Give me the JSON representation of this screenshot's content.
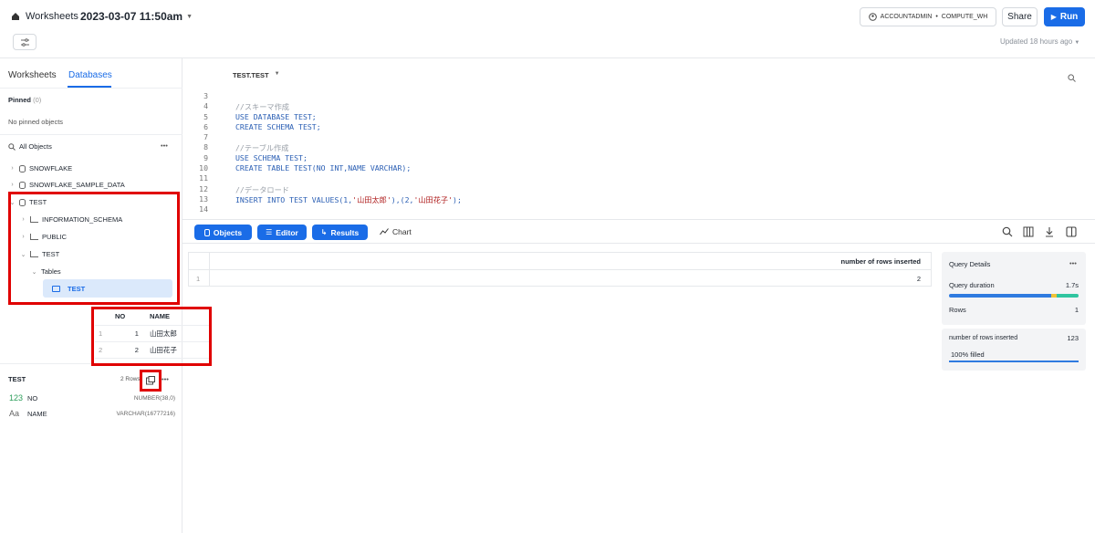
{
  "header": {
    "breadcrumb": "Worksheets",
    "worksheet_title": "2023-03-07 11:50am",
    "role": "ACCOUNTADMIN",
    "separator": "•",
    "warehouse": "COMPUTE_WH",
    "share_label": "Share",
    "run_label": "Run",
    "updated": "Updated 18 hours ago"
  },
  "sidebar": {
    "tabs": [
      "Worksheets",
      "Databases"
    ],
    "pinned_label": "Pinned",
    "pinned_count": "(0)",
    "no_pinned": "No pinned objects",
    "all_objects": "All Objects",
    "more": "•••",
    "tree": {
      "snowflake": "SNOWFLAKE",
      "sample": "SNOWFLAKE_SAMPLE_DATA",
      "test_db": "TEST",
      "info_schema": "INFORMATION_SCHEMA",
      "public": "PUBLIC",
      "test_schema": "TEST",
      "tables": "Tables",
      "test_table": "TEST"
    },
    "preview": {
      "headers": [
        "NO",
        "NAME"
      ],
      "rows": [
        {
          "n": "1",
          "no": "1",
          "name": "山田太郎"
        },
        {
          "n": "2",
          "no": "2",
          "name": "山田花子"
        }
      ]
    },
    "details": {
      "table_name": "TEST",
      "rows_label": "2 Rows",
      "columns": [
        {
          "icon": "123",
          "name": "NO",
          "type": "NUMBER(38,0)"
        },
        {
          "icon": "Aa",
          "name": "NAME",
          "type": "VARCHAR(16777216)"
        }
      ]
    }
  },
  "editor": {
    "context": "TEST.TEST",
    "lines": [
      {
        "n": "3",
        "text": ""
      },
      {
        "n": "4",
        "text": "//スキーマ作成"
      },
      {
        "n": "5",
        "text": "USE DATABASE TEST;"
      },
      {
        "n": "6",
        "text": "CREATE SCHEMA TEST;"
      },
      {
        "n": "7",
        "text": ""
      },
      {
        "n": "8",
        "text": "//テーブル作成"
      },
      {
        "n": "9",
        "text": "USE SCHEMA TEST;"
      },
      {
        "n": "10",
        "text": "CREATE TABLE TEST(NO INT,NAME VARCHAR);"
      },
      {
        "n": "11",
        "text": ""
      },
      {
        "n": "12",
        "text": "//データロード"
      },
      {
        "n": "13",
        "text": "INSERT INTO TEST VALUES(1,'山田太郎'),(2,'山田花子');"
      },
      {
        "n": "14",
        "text": ""
      }
    ]
  },
  "results": {
    "toolbar": {
      "objects": "Objects",
      "editor": "Editor",
      "results": "Results",
      "chart": "Chart"
    },
    "column_header": "number of rows inserted",
    "row_num": "1",
    "value": "2"
  },
  "query_details": {
    "title": "Query Details",
    "more": "•••",
    "duration_label": "Query duration",
    "duration": "1.7s",
    "rows_label": "Rows",
    "rows": "1",
    "col_label": "number of rows inserted",
    "col_value": "123",
    "filled": "100% filled"
  },
  "colors": {
    "accent": "#1a6ce7",
    "highlight": "#e00000"
  }
}
